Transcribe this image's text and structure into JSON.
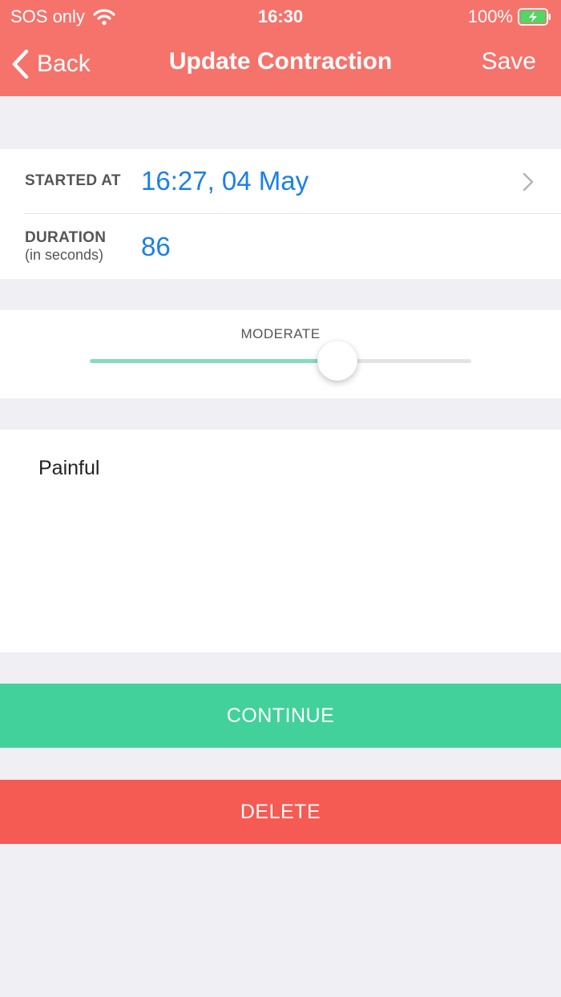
{
  "status_bar": {
    "carrier": "SOS only",
    "time": "16:30",
    "battery": "100%",
    "icons": [
      "wifi-icon",
      "battery-charging-icon"
    ]
  },
  "nav": {
    "back_label": "Back",
    "title": "Update Contraction",
    "save_label": "Save",
    "icons": [
      "chevron-left-icon"
    ]
  },
  "form": {
    "started_label": "STARTED AT",
    "started_value": "16:27, 04 May",
    "duration_label": "DURATION",
    "duration_sublabel": "(in seconds)",
    "duration_value": "86"
  },
  "intensity": {
    "label": "MODERATE",
    "level": 0.65
  },
  "notes": {
    "text": "Painful"
  },
  "actions": {
    "continue_label": "CONTINUE",
    "delete_label": "DELETE"
  },
  "colors": {
    "header": "#f5736b",
    "value_blue": "#1a80e8",
    "continue_green": "#42d19b",
    "delete_red": "#f55b53",
    "slider_fill": "#84dcc0",
    "background": "#efeff4"
  }
}
